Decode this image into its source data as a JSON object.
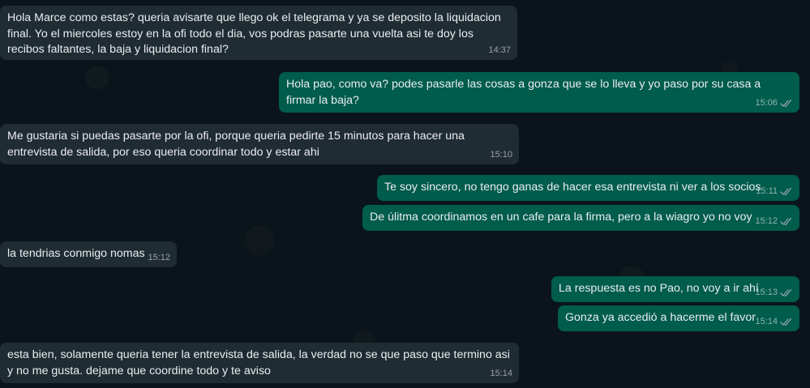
{
  "messages": [
    {
      "direction": "in",
      "text": "Hola Marce como estas? queria avisarte que llego ok el telegrama y ya se deposito la liquidacion final. Yo el miercoles estoy en la ofi todo el dia, vos podras pasarte una vuelta asi te doy los recibos faltantes, la baja y liquidacion final?",
      "time": "14:37"
    },
    {
      "direction": "out",
      "text": "Hola pao, como va? podes pasarle las cosas a gonza que se lo lleva y yo paso por su casa a firmar la baja?",
      "time": "15:06",
      "status": "read"
    },
    {
      "direction": "in",
      "text": "Me gustaria si puedas pasarte por la ofi, porque queria pedirte 15 minutos para hacer una entrevista de salida, por eso queria coordinar todo y estar ahi",
      "time": "15:10"
    },
    {
      "direction": "out",
      "text": "Te soy sincero, no tengo ganas de hacer esa entrevista ni ver a los socios",
      "time": "15:11",
      "status": "read"
    },
    {
      "direction": "out",
      "text": "De úlitma coordinamos en un cafe para la firma, pero a la wiagro yo no voy",
      "time": "15:12",
      "status": "read"
    },
    {
      "direction": "in",
      "text": "la tendrias conmigo nomas",
      "time": "15:12"
    },
    {
      "direction": "out",
      "text": "La respuesta es no Pao, no voy a ir ahí",
      "time": "15:13",
      "status": "read"
    },
    {
      "direction": "out",
      "text": "Gonza ya accedió a hacerme el favor",
      "time": "15:14",
      "status": "read"
    },
    {
      "direction": "in",
      "text": "esta bien, solamente queria tener la entrevista de salida, la verdad no se que paso que termino asi y no me gusta. dejame que coordine todo y te aviso",
      "time": "15:14"
    }
  ],
  "icons": {
    "read_status": "double-check-icon"
  },
  "colors": {
    "background": "#0b141a",
    "incoming_bubble": "#202c33",
    "outgoing_bubble": "#005c4b",
    "text": "#e9edef",
    "meta": "#9fb0b6"
  }
}
